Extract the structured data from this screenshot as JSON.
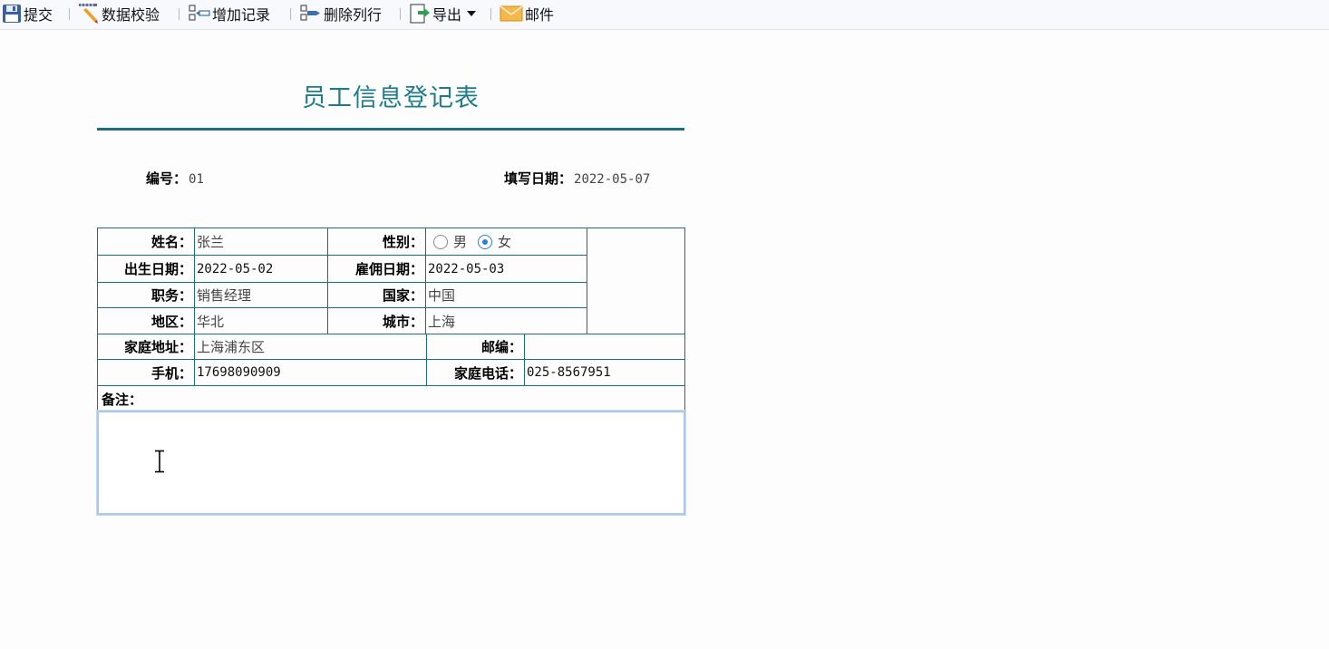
{
  "toolbar": {
    "submit": "提交",
    "validate": "数据校验",
    "add_record": "增加记录",
    "delete_row": "删除列行",
    "export": "导出",
    "mail": "邮件"
  },
  "form": {
    "title": "员工信息登记表",
    "id_label": "编号：",
    "id_value": "01",
    "date_label": "填写日期：",
    "date_value": "2022-05-07",
    "name_label": "姓名：",
    "name_value": "张兰",
    "gender_label": "性别：",
    "gender_options": [
      "男",
      "女"
    ],
    "gender_selected": "女",
    "birth_label": "出生日期：",
    "birth_value": "2022-05-02",
    "hire_label": "雇佣日期：",
    "hire_value": "2022-05-03",
    "position_label": "职务：",
    "position_value": "销售经理",
    "country_label": "国家：",
    "country_value": "中国",
    "region_label": "地区：",
    "region_value": "华北",
    "city_label": "城市：",
    "city_value": "上海",
    "address_label": "家庭地址：",
    "address_value": "上海浦东区",
    "zip_label": "邮编：",
    "zip_value": "",
    "mobile_label": "手机：",
    "mobile_value": "17698090909",
    "phone_label": "家庭电话：",
    "phone_value": "025-8567951",
    "remarks_label": "备注：",
    "remarks_value": ""
  },
  "colors": {
    "accent": "#1e6f7c",
    "title": "#1e7b8a",
    "radio_selected": "#2f7fd8"
  },
  "icons": [
    "save-icon",
    "pencil-ruler-icon",
    "add-record-icon",
    "delete-row-icon",
    "export-icon",
    "mail-icon",
    "chevron-down-icon",
    "text-cursor-icon"
  ]
}
